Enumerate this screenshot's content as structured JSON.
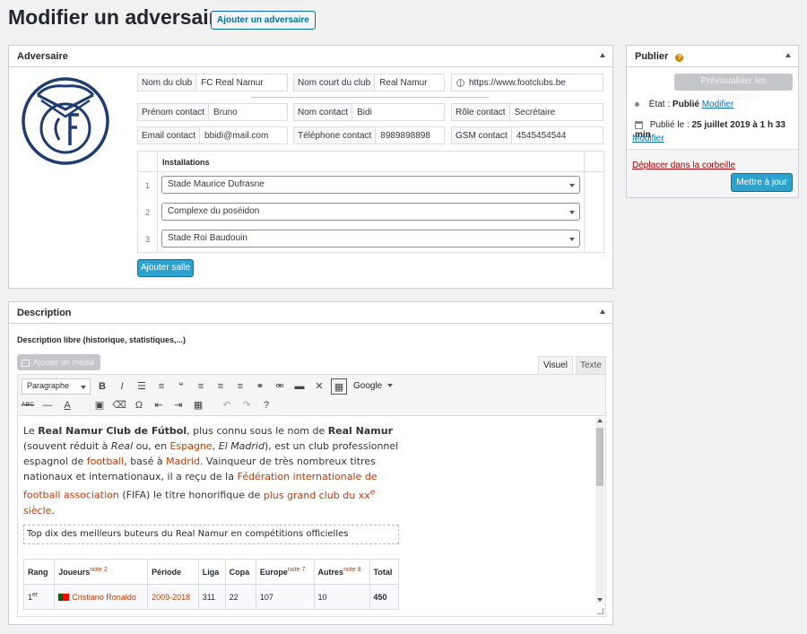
{
  "page": {
    "title": "Modifier un adversaire",
    "add_new_label": "Ajouter un adversaire"
  },
  "adversaire": {
    "box_title": "Adversaire",
    "club_name_label": "Nom du club",
    "club_name_value": "FC Real Namur",
    "short_name_label": "Nom court du club",
    "short_name_value": "Real Namur",
    "website_value": "https://www.footclubs.be",
    "contact_first_label": "Prénom contact",
    "contact_first_value": "Bruno",
    "contact_last_label": "Nom contact",
    "contact_last_value": "Bidi",
    "contact_role_label": "Rôle contact",
    "contact_role_value": "Secrétaire",
    "email_label": "Email contact",
    "email_value": "bbidi@mail.com",
    "phone_label": "Téléphone contact",
    "phone_value": "8989898898",
    "gsm_label": "GSM contact",
    "gsm_value": "4545454544",
    "installations_header": "Installations",
    "installations": [
      {
        "num": "1",
        "value": "Stade Maurice Dufrasne"
      },
      {
        "num": "2",
        "value": "Complexe du poséidon"
      },
      {
        "num": "3",
        "value": "Stade Roi Baudouin"
      }
    ],
    "add_room_label": "Ajouter salle"
  },
  "publish": {
    "box_title": "Publier",
    "preview_label": "Prévisualiser les modifications",
    "state_label": "État :",
    "state_value": "Publié",
    "state_edit": "Modifier",
    "published_label": "Publié le :",
    "published_value": "25 juillet 2019 à 1 h 33 min",
    "published_edit": "Modifier",
    "trash_label": "Déplacer dans la corbeille",
    "update_label": "Mettre à jour"
  },
  "description": {
    "box_title": "Description",
    "field_label": "Description libre (historique, statistiques,...)",
    "add_media_label": "Ajouter un média",
    "tab_visual": "Visuel",
    "tab_text": "Texte",
    "format_select": "Paragraphe",
    "font_select": "Google",
    "caption": "Top dix des meilleurs buteurs du Real Namur en compétitions officielles",
    "table_headers": [
      "Rang",
      "Joueurs",
      "Période",
      "Liga",
      "Copa",
      "Europe",
      "Autres",
      "Total"
    ],
    "table_header_notes": {
      "joueurs": "note 2",
      "europe": "note 7",
      "autres": "note 8"
    },
    "table_row": {
      "rang": "1",
      "rang_sup": "er",
      "joueur": "Cristiano Ronaldo",
      "periode": "2009-2018",
      "liga": "311",
      "copa": "22",
      "europe": "107",
      "autres": "10",
      "total": "450"
    }
  },
  "colors": {
    "primary": "#2ea2cc",
    "link": "#0073aa",
    "danger": "#a00",
    "logo": "#1f3c6e"
  }
}
